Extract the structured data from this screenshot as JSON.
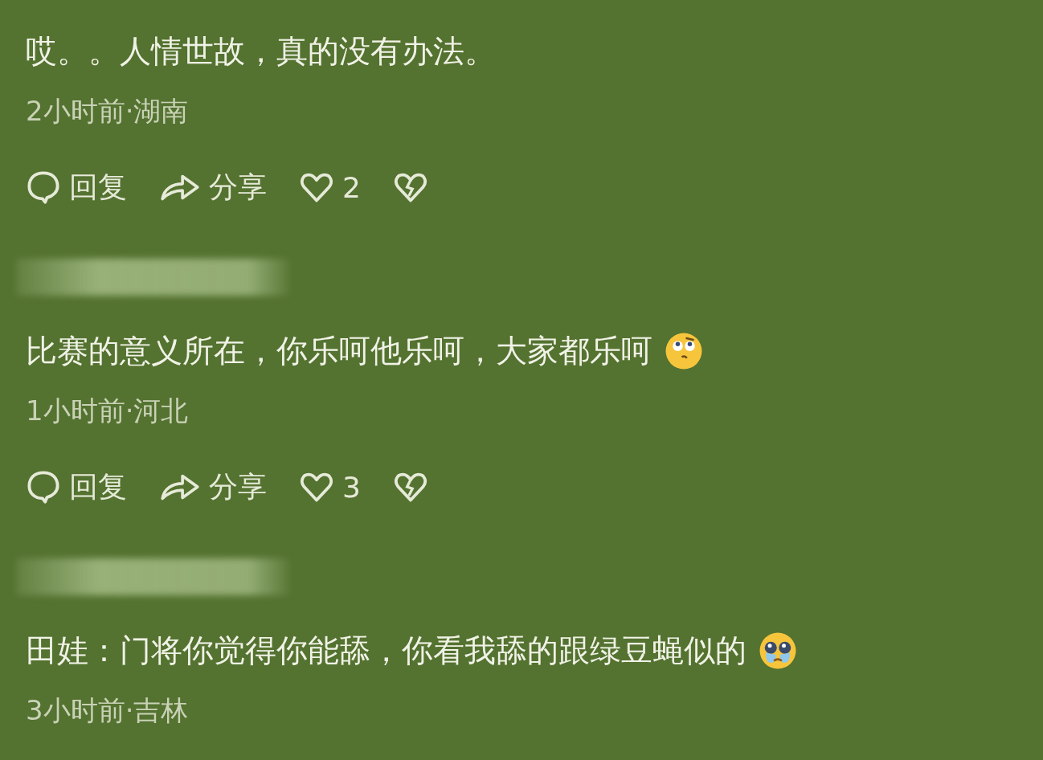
{
  "comments": [
    {
      "author_blurred": false,
      "text": "哎。。人情世故，真的没有办法。",
      "meta": "2小时前·湖南",
      "actions": {
        "reply": "回复",
        "share": "分享",
        "likes": "2"
      }
    },
    {
      "author_blurred": true,
      "text": "比赛的意义所在，你乐呵他乐呵，大家都乐呵",
      "emoji": {
        "kind": "smirk"
      },
      "meta": "1小时前·河北",
      "actions": {
        "reply": "回复",
        "share": "分享",
        "likes": "3"
      }
    },
    {
      "author_blurred": true,
      "text": "田娃：门将你觉得你能舔，你看我舔的跟绿豆蝇似的",
      "emoji": {
        "kind": "crying"
      },
      "meta": "3小时前·吉林"
    }
  ]
}
